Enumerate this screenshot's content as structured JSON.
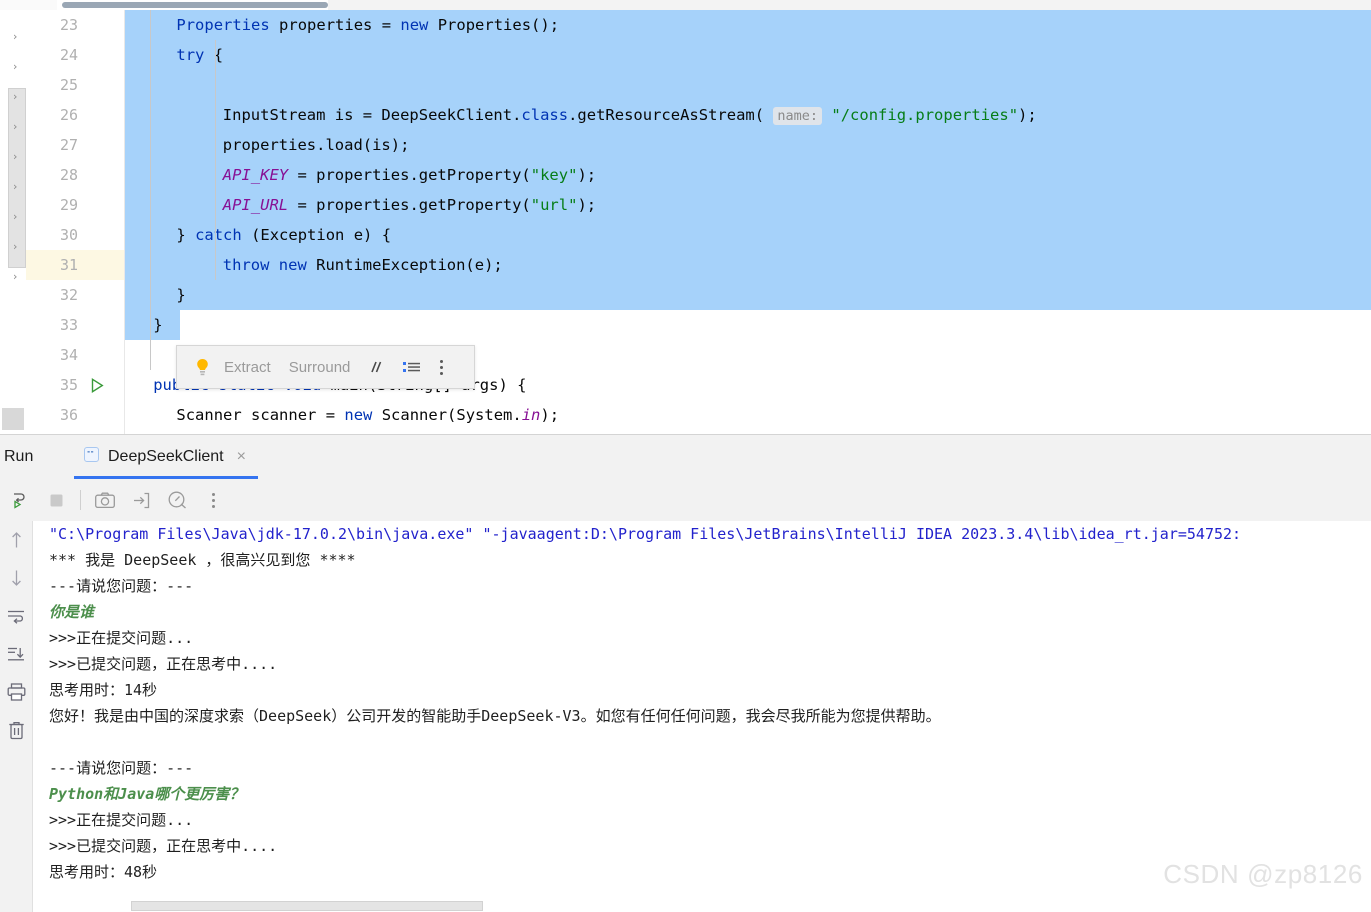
{
  "editor": {
    "first_line_number": 23,
    "highlighted_line": 31,
    "run_marker_line": 35,
    "selection_color": "#a6d2fa",
    "highlight_color": "#fdf8e3",
    "lines": [
      {
        "num": "23",
        "indent": 4,
        "sel": "full",
        "html": "<span class=\"cls\">Properties</span> properties = <span class=\"kw\">new</span> Properties();"
      },
      {
        "num": "24",
        "indent": 4,
        "sel": "full",
        "html": "<span class=\"kw\">try</span> {"
      },
      {
        "num": "25",
        "indent": 0,
        "sel": "full",
        "html": ""
      },
      {
        "num": "26",
        "indent": 8,
        "sel": "full",
        "html": "InputStream is = DeepSeekClient.<span class=\"kw\">class</span>.getResourceAsStream( <span class=\"hintchip\">name:</span> <span class=\"str\">\"/config.properties\"</span>);"
      },
      {
        "num": "27",
        "indent": 8,
        "sel": "full",
        "html": "properties.load(is);"
      },
      {
        "num": "28",
        "indent": 8,
        "sel": "full",
        "html": "<span class=\"fld\">API_KEY</span> = properties.getProperty(<span class=\"str\">\"key\"</span>);"
      },
      {
        "num": "29",
        "indent": 8,
        "sel": "full",
        "html": "<span class=\"fld\">API_URL</span> = properties.getProperty(<span class=\"str\">\"url\"</span>);"
      },
      {
        "num": "30",
        "indent": 4,
        "sel": "full",
        "html": "} <span class=\"kw\">catch</span> (Exception e) {"
      },
      {
        "num": "31",
        "indent": 8,
        "sel": "full",
        "html": "<span class=\"kw\">throw new</span> RuntimeException(e);"
      },
      {
        "num": "32",
        "indent": 4,
        "sel": "full",
        "html": "}"
      },
      {
        "num": "33",
        "indent": 2,
        "sel": "partial",
        "html": "}"
      },
      {
        "num": "34",
        "indent": 0,
        "sel": "none",
        "html": ""
      },
      {
        "num": "35",
        "indent": 2,
        "sel": "none",
        "html": "<span class=\"kw\">public static void</span> main(String[] args) {"
      },
      {
        "num": "36",
        "indent": 4,
        "sel": "none",
        "html": "Scanner scanner = <span class=\"kw\">new</span> Scanner(System.<span class=\"fld\">in</span>);"
      }
    ],
    "plain_lines": [
      "        Properties properties = new Properties();",
      "        try {",
      "",
      "            InputStream is = DeepSeekClient.class.getResourceAsStream( name: \"/config.properties\");",
      "            properties.load(is);",
      "            API_KEY = properties.getProperty(\"key\");",
      "            API_URL = properties.getProperty(\"url\");",
      "        } catch (Exception e) {",
      "            throw new RuntimeException(e);",
      "        }",
      "    }",
      "",
      "    public static void main(String[] args) {",
      "        Scanner scanner = new Scanner(System.in);"
    ]
  },
  "intention_bar": {
    "bulb_icon": "lightbulb-icon",
    "items": [
      {
        "label": "Extract",
        "icon": ""
      },
      {
        "label": "Surround",
        "icon": ""
      },
      {
        "label": "",
        "icon": "comment-icon"
      },
      {
        "label": "",
        "icon": "reformat-icon"
      },
      {
        "label": "",
        "icon": "more-options-icon"
      }
    ]
  },
  "run_panel": {
    "title": "Run",
    "tab": {
      "icon": "run-config-icon",
      "label": "DeepSeekClient",
      "close_label": "×"
    },
    "toolbar": [
      {
        "name": "rerun-button",
        "icon": "rerun-icon"
      },
      {
        "name": "stop-button",
        "icon": "stop-icon"
      },
      {
        "name": "screenshot-button",
        "icon": "camera-icon"
      },
      {
        "name": "thread-dump-button",
        "icon": "arrow-into-box-icon"
      },
      {
        "name": "profiler-button",
        "icon": "gauge-icon"
      },
      {
        "name": "more-button",
        "icon": "more-options-icon"
      }
    ],
    "side_toolbar": [
      {
        "name": "previous-occurrence-button",
        "icon": "arrow-up-icon"
      },
      {
        "name": "next-occurrence-button",
        "icon": "arrow-down-icon"
      },
      {
        "name": "soft-wrap-button",
        "icon": "soft-wrap-icon"
      },
      {
        "name": "scroll-to-end-button",
        "icon": "scroll-to-end-icon"
      },
      {
        "name": "print-button",
        "icon": "printer-icon"
      },
      {
        "name": "clear-all-button",
        "icon": "trash-icon"
      }
    ]
  },
  "console": {
    "lines": [
      {
        "style": "blue",
        "text": "\"C:\\Program Files\\Java\\jdk-17.0.2\\bin\\java.exe\" \"-javaagent:D:\\Program Files\\JetBrains\\IntelliJ IDEA 2023.3.4\\lib\\idea_rt.jar=54752:"
      },
      {
        "style": "black",
        "text": "*** 我是 DeepSeek ，很高兴见到您 ****"
      },
      {
        "style": "black",
        "text": "---请说您问题：---"
      },
      {
        "style": "green",
        "text": "你是谁"
      },
      {
        "style": "black",
        "text": ">>>正在提交问题..."
      },
      {
        "style": "black",
        "text": ">>>已提交问题，正在思考中...."
      },
      {
        "style": "black",
        "text": "思考用时：14秒"
      },
      {
        "style": "black",
        "text": "您好！我是由中国的深度求索（DeepSeek）公司开发的智能助手DeepSeek-V3。如您有任何任何问题，我会尽我所能为您提供帮助。"
      },
      {
        "style": "black",
        "text": ""
      },
      {
        "style": "black",
        "text": "---请说您问题：---"
      },
      {
        "style": "green",
        "text": "Python和Java哪个更厉害？"
      },
      {
        "style": "black",
        "text": ">>>正在提交问题..."
      },
      {
        "style": "black",
        "text": ">>>已提交问题，正在思考中...."
      },
      {
        "style": "black",
        "text": "思考用时：48秒"
      }
    ]
  },
  "watermark": {
    "text": "CSDN @zp8126"
  }
}
